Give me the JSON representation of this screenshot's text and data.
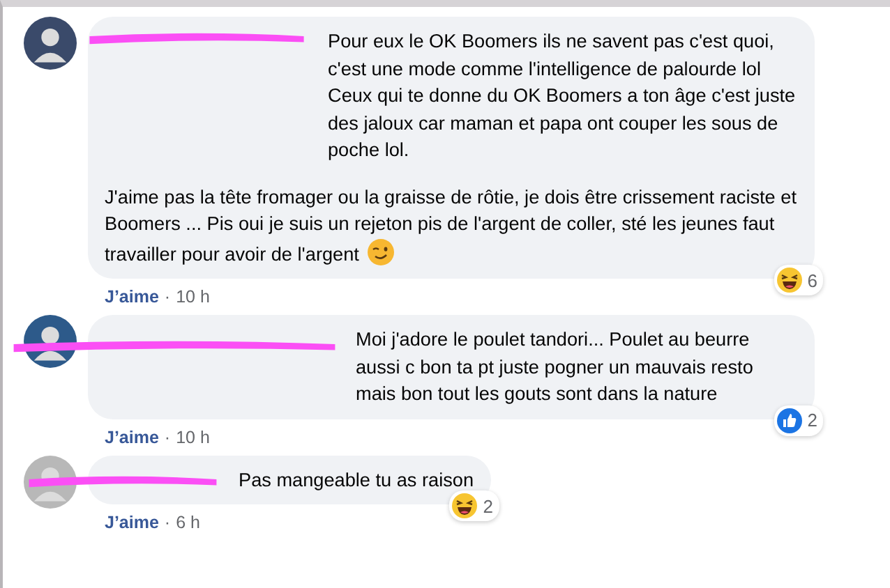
{
  "comments": [
    {
      "paragraphs": [
        {
          "text": "Pour eux le OK Boomers ils ne savent pas c'est quoi, c'est une mode comme l'intelligence de palourde lol Ceux qui te donne du OK Boomers a ton âge c'est juste des jaloux car maman et papa ont couper les sous de poche lol."
        },
        {
          "text": "J'aime pas la tête fromager ou la graisse de rôtie, je dois être crissement raciste et Boomers ... Pis oui je suis un rejeton pis de l'argent de coller, sté les jeunes faut travailler pour avoir de l'argent",
          "icon": true
        }
      ],
      "reaction": {
        "kind": "haha",
        "count": "6"
      },
      "like": "J’aime",
      "sep": "·",
      "time": "10 h"
    },
    {
      "paragraphs": [
        {
          "text": "Moi j'adore le poulet tandori... Poulet au beurre aussi c bon ta pt juste pogner un mauvais resto mais bon tout les gouts sont dans la nature"
        }
      ],
      "reaction": {
        "kind": "like",
        "count": "2"
      },
      "like": "J’aime",
      "sep": "·",
      "time": "10 h"
    },
    {
      "paragraphs": [
        {
          "text": "Pas mangeable tu as raison"
        }
      ],
      "reaction": {
        "kind": "haha",
        "count": "2"
      },
      "like": "J’aime",
      "sep": "·",
      "time": "6 h"
    }
  ]
}
